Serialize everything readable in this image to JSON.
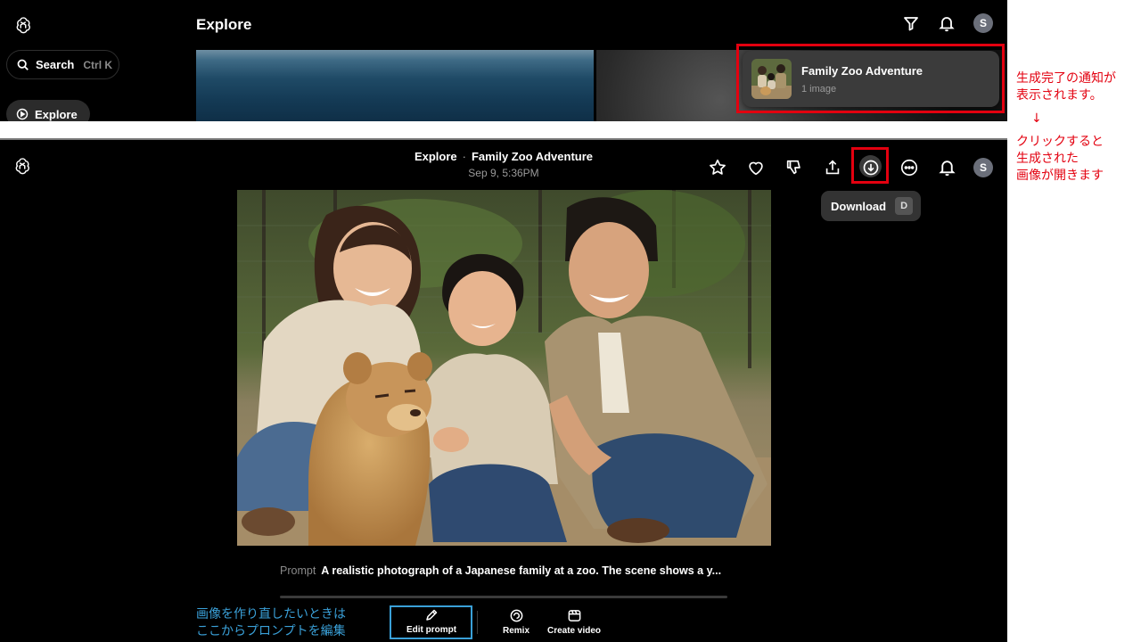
{
  "top": {
    "title": "Explore",
    "search": {
      "label": "Search",
      "shortcut": "Ctrl K"
    },
    "nav_explore": "Explore",
    "avatar_initial": "S",
    "notification": {
      "title": "Family Zoo Adventure",
      "subtitle": "1 image"
    }
  },
  "viewer": {
    "breadcrumb_root": "Explore",
    "breadcrumb_sep": "·",
    "breadcrumb_title": "Family Zoo Adventure",
    "date": "Sep 9, 5:36PM",
    "avatar_initial": "S",
    "tooltip": {
      "label": "Download",
      "key": "D"
    },
    "prompt_label": "Prompt",
    "prompt_text": "A realistic photograph of a Japanese family at a zoo. The scene shows a y...",
    "tools": {
      "edit": "Edit prompt",
      "remix": "Remix",
      "video": "Create video"
    }
  },
  "annotations": {
    "red_top_line1": "生成完了の通知が",
    "red_top_line2": "表示されます。",
    "arrow": "↓",
    "red_bottom_line1": "クリックすると",
    "red_bottom_line2": "生成された",
    "red_bottom_line3": "画像が開きます",
    "blue_line1": "画像を作り直したいときは",
    "blue_line2": "ここからプロンプトを編集"
  },
  "colors": {
    "highlight_red": "#e3000f",
    "highlight_blue": "#3aa0d8",
    "background": "#000000"
  },
  "icons": [
    "openai-logo-icon",
    "search-icon",
    "explore-icon",
    "filter-icon",
    "bell-icon",
    "star-icon",
    "heart-icon",
    "thumbs-down-icon",
    "share-icon",
    "download-icon",
    "more-icon",
    "pencil-icon",
    "remix-icon",
    "video-icon"
  ]
}
